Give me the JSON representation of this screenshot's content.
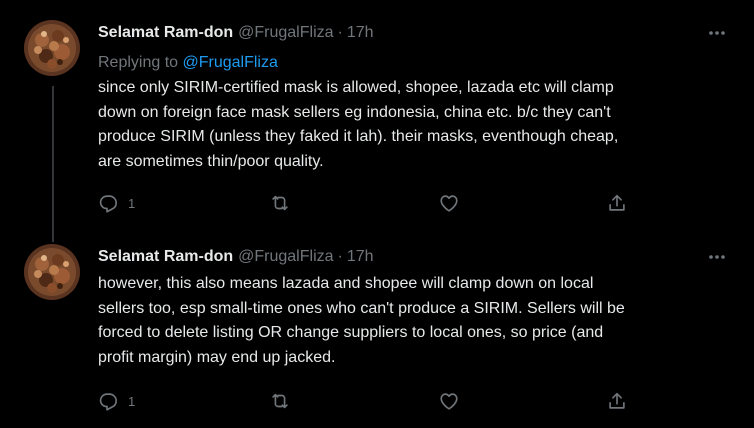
{
  "tweets": [
    {
      "display_name": "Selamat Ram-don",
      "handle": "@FrugalFliza",
      "separator": "·",
      "timestamp": "17h",
      "replying_prefix": "Replying to",
      "replying_to": "@FrugalFliza",
      "text": "since only SIRIM-certified mask is allowed, shopee, lazada etc will clamp\ndown on foreign face mask sellers eg indonesia, china etc. b/c they can't\nproduce SIRIM (unless they faked it lah). their masks, eventhough cheap,\nare sometimes thin/poor quality.",
      "reply_count": "1"
    },
    {
      "display_name": "Selamat Ram-don",
      "handle": "@FrugalFliza",
      "separator": "·",
      "timestamp": "17h",
      "text": "however, this also means lazada and shopee will clamp down on local\nsellers too, esp small-time ones who can't produce a SIRIM. Sellers will be\nforced to delete listing OR change suppliers to local ones, so price (and\nprofit margin) may end up jacked.",
      "reply_count": "1"
    }
  ],
  "icons": {
    "avatar": "food-photo-avatar",
    "more": "more-dots-icon",
    "reply": "reply-icon",
    "retweet": "retweet-icon",
    "like": "like-icon",
    "share": "share-icon"
  },
  "colors": {
    "background": "#000000",
    "primary_text": "#e7e9ea",
    "secondary_text": "#71767b",
    "link": "#1d9bf0",
    "thread_line": "#333639"
  }
}
